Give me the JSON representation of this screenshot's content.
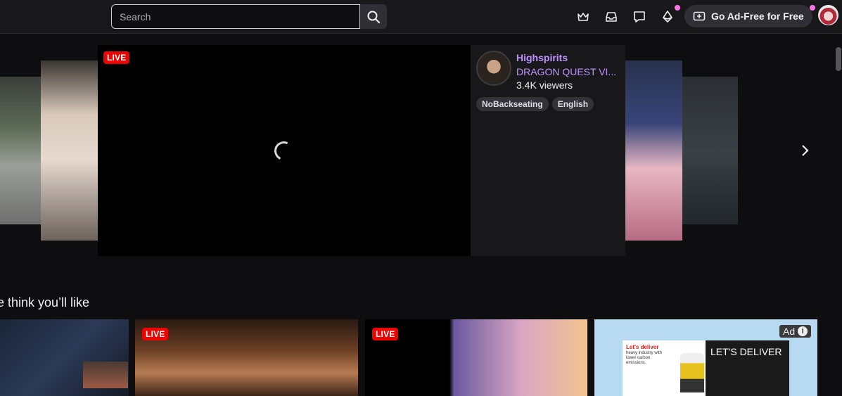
{
  "topbar": {
    "search_placeholder": "Search",
    "ad_free_label": "Go Ad-Free for Free",
    "icons": [
      "search-icon",
      "prime-crown-icon",
      "inbox-icon",
      "whispers-icon",
      "bits-icon",
      "ad-free-icon",
      "user-avatar"
    ]
  },
  "featured": {
    "live_label": "LIVE",
    "channel_name": "Highspirits",
    "game": "DRAGON QUEST VI...",
    "viewers": "3.4K viewers",
    "tags": [
      "NoBackseating",
      "English"
    ]
  },
  "recommended": {
    "section_title": "e think you’ll like",
    "cards": [
      {
        "live": ""
      },
      {
        "live": "LIVE"
      },
      {
        "live": "LIVE"
      },
      {
        "ad_label": "Ad",
        "ad_info": "i",
        "ad_headline": "Let's deliver",
        "ad_subtext": "heavy industry with lower carbon emissions.",
        "ad_title": "LET'S DELIVER"
      }
    ]
  },
  "colors": {
    "accent": "#bf94ff",
    "live": "#eb0400",
    "notification_dot": "#ff75e6",
    "background": "#0e0e10"
  }
}
